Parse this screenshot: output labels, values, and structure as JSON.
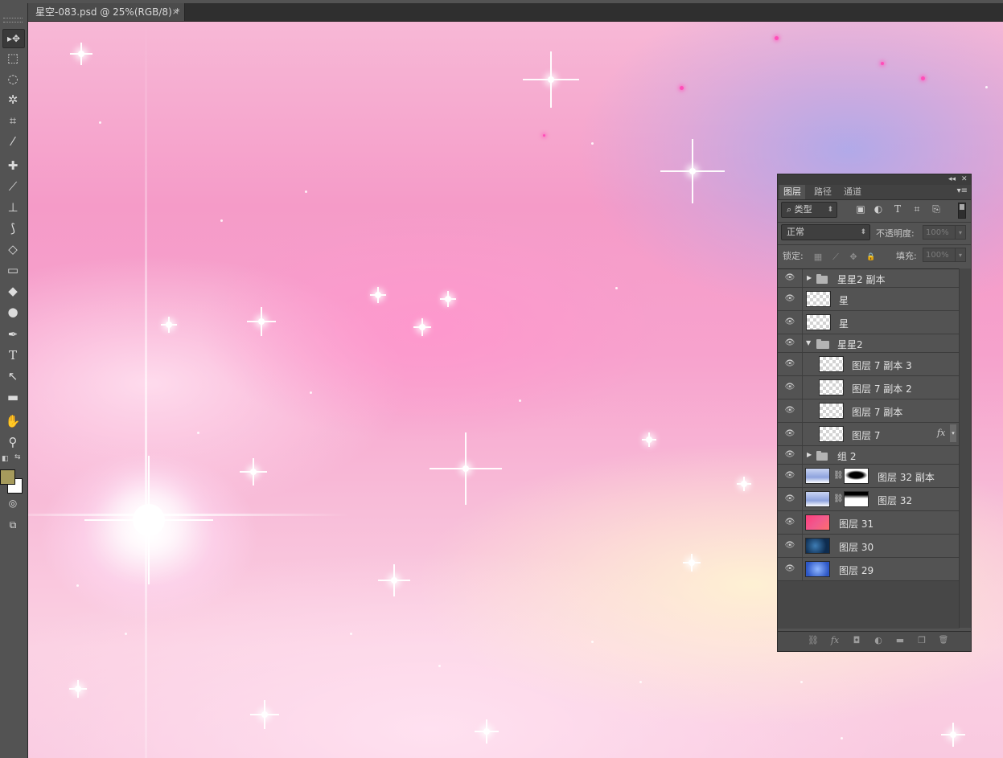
{
  "document_tab": {
    "title": "星空-083.psd @ 25%(RGB/8) *",
    "close": "×"
  },
  "toolbar": {
    "tools": [
      {
        "name": "move-tool",
        "glyph": "▸✥"
      },
      {
        "name": "marquee-tool",
        "glyph": "⬚"
      },
      {
        "name": "lasso-tool",
        "glyph": "◌"
      },
      {
        "name": "magic-wand-tool",
        "glyph": "✲"
      },
      {
        "name": "crop-tool",
        "glyph": "⌗"
      },
      {
        "name": "eyedropper-tool",
        "glyph": "⁄"
      },
      {
        "name": "healing-brush-tool",
        "glyph": "✚"
      },
      {
        "name": "brush-tool",
        "glyph": "⟋"
      },
      {
        "name": "stamp-tool",
        "glyph": "⊥"
      },
      {
        "name": "history-brush-tool",
        "glyph": "⟆"
      },
      {
        "name": "eraser-tool",
        "glyph": "◇"
      },
      {
        "name": "gradient-tool",
        "glyph": "▭"
      },
      {
        "name": "blur-tool",
        "glyph": "◆"
      },
      {
        "name": "dodge-tool",
        "glyph": "●"
      },
      {
        "name": "pen-tool",
        "glyph": "✒"
      },
      {
        "name": "type-tool",
        "glyph": "T"
      },
      {
        "name": "path-selection-tool",
        "glyph": "↖"
      },
      {
        "name": "rectangle-tool",
        "glyph": "▬"
      },
      {
        "name": "hand-tool",
        "glyph": "✋"
      },
      {
        "name": "zoom-tool",
        "glyph": "⚲"
      }
    ],
    "foreground_color": "#a69b5c",
    "background_color": "#ffffff"
  },
  "panel": {
    "collapse": "◂◂",
    "close": "✕",
    "tabs": [
      "图层",
      "路径",
      "通道"
    ],
    "menu": "▾≡",
    "filter_kind": "类型",
    "filter_search_glyph": "⌕",
    "filter_icons": [
      "▣",
      "◐",
      "T",
      "⌗",
      "⎘"
    ],
    "blend_mode": "正常",
    "opacity_label": "不透明度:",
    "opacity_value": "100%",
    "lock_label": "锁定:",
    "lock_icons": [
      "▦",
      "⟋",
      "✥",
      "🔒"
    ],
    "fill_label": "填充:",
    "fill_value": "100%",
    "eye": "👁",
    "layers": [
      {
        "name": "星星2 副本",
        "type": "group-collapsed"
      },
      {
        "name": "星",
        "type": "transparent"
      },
      {
        "name": "星",
        "type": "transparent"
      },
      {
        "name": "星星2",
        "type": "group-expanded"
      },
      {
        "name": "图层 7 副本 3",
        "type": "transparent-indent"
      },
      {
        "name": "图层 7 副本 2",
        "type": "transparent-indent"
      },
      {
        "name": "图层 7 副本",
        "type": "transparent-indent"
      },
      {
        "name": "图层 7",
        "type": "transparent-indent-fx",
        "fx": "fx"
      },
      {
        "name": "组 2",
        "type": "group-collapsed"
      },
      {
        "name": "图层 32 副本",
        "type": "masked"
      },
      {
        "name": "图层 32",
        "type": "masked"
      },
      {
        "name": "图层 31",
        "type": "image-red"
      },
      {
        "name": "图层 30",
        "type": "image-space"
      },
      {
        "name": "图层 29",
        "type": "image-blue"
      }
    ],
    "footer_icons": [
      "⛓",
      "fx",
      "◘",
      "◐",
      "▬",
      "❐",
      "🗑"
    ]
  }
}
